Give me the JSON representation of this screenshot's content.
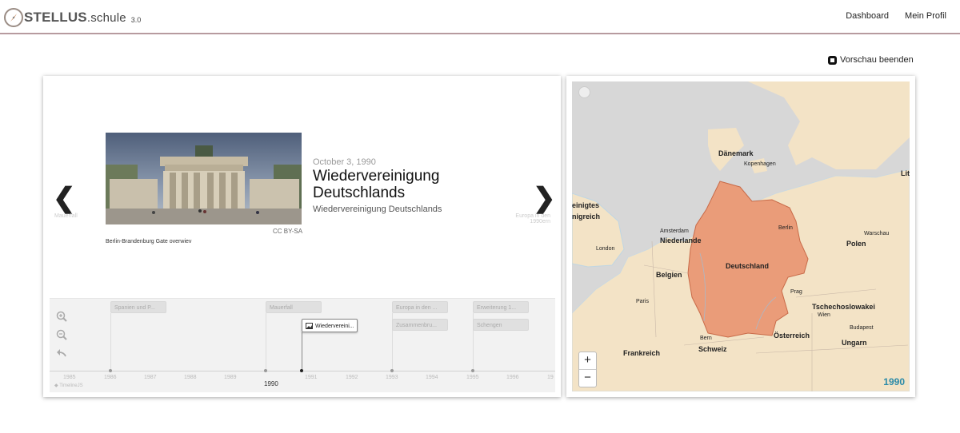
{
  "header": {
    "logo_brand": "STELLUS",
    "logo_domain": ".schule",
    "logo_version": "3.0",
    "nav": [
      "Dashboard",
      "Mein Profil"
    ]
  },
  "preview": {
    "end_label": "Vorschau beenden"
  },
  "slide": {
    "date": "October 3, 1990",
    "title": "Wiedervereinigung Deutschlands",
    "subtitle": "Wiedervereinigung Deutschlands",
    "image_credit": "CC BY-SA",
    "image_caption": "Berlin-Brandenburg Gate overwiev",
    "prev_label": "Mauerfall",
    "next_label": "Europa in den 1990ern"
  },
  "timeline": {
    "markers": [
      {
        "label": "Spanien und P..."
      },
      {
        "label": "Mauerfall"
      },
      {
        "label": "Wiedervereini..."
      },
      {
        "label": "Europa in den ..."
      },
      {
        "label": "Zusammenbru..."
      },
      {
        "label": "Erweiterung 1..."
      },
      {
        "label": "Schengen"
      }
    ],
    "years": [
      "1985",
      "1986",
      "1987",
      "1988",
      "1989",
      "1990",
      "1991",
      "1992",
      "1993",
      "1994",
      "1995",
      "1996",
      "19"
    ],
    "attribution": "TimelineJS"
  },
  "map": {
    "labels": {
      "daenemark": "Dänemark",
      "kopenhagen": "Kopenhagen",
      "vereinigtes": "einigtes",
      "koenigreich": "nigreich",
      "amsterdam": "Amsterdam",
      "niederlande": "Niederlande",
      "london": "London",
      "berlin": "Berlin",
      "warschau": "Warschau",
      "polen": "Polen",
      "deutschland": "Deutschland",
      "belgien": "Belgien",
      "paris": "Paris",
      "prag": "Prag",
      "tschecho": "Tschechoslowakei",
      "wien": "Wien",
      "budapest": "Budapest",
      "ungarn": "Ungarn",
      "oesterreich": "Österreich",
      "frankreich": "Frankreich",
      "bern": "Bern",
      "schweiz": "Schweiz",
      "lit": "Lit"
    },
    "zoom_in": "+",
    "zoom_out": "−",
    "year": "1990",
    "colors": {
      "land": "#f3e3c6",
      "sea": "#d7d7d7",
      "highlight": "#ea9c79",
      "year": "#2a8aa8"
    }
  }
}
